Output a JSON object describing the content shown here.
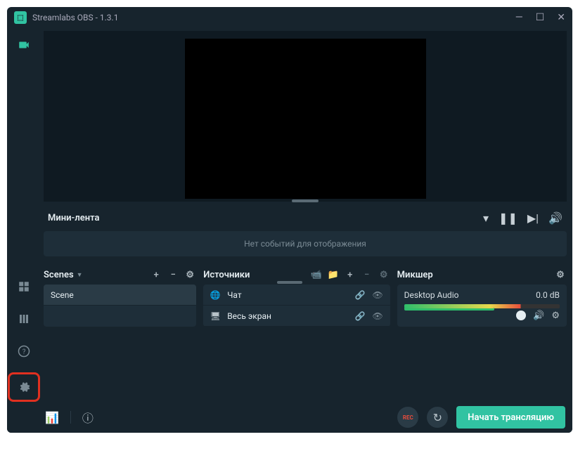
{
  "title": "Streamlabs OBS - 1.3.1",
  "accent": "#31C3A2",
  "minifeed": {
    "title": "Мини-лента",
    "empty": "Нет событий для отображения"
  },
  "scenes": {
    "title": "Scenes",
    "items": [
      "Scene"
    ]
  },
  "sources": {
    "title": "Источники",
    "items": [
      {
        "icon": "globe",
        "label": "Чат"
      },
      {
        "icon": "monitor",
        "label": "Весь экран"
      }
    ]
  },
  "mixer": {
    "title": "Микшер",
    "channels": [
      {
        "name": "Desktop Audio",
        "level": "0.0 dB"
      }
    ]
  },
  "footer": {
    "rec": "REC",
    "golive": "Начать трансляцию"
  }
}
